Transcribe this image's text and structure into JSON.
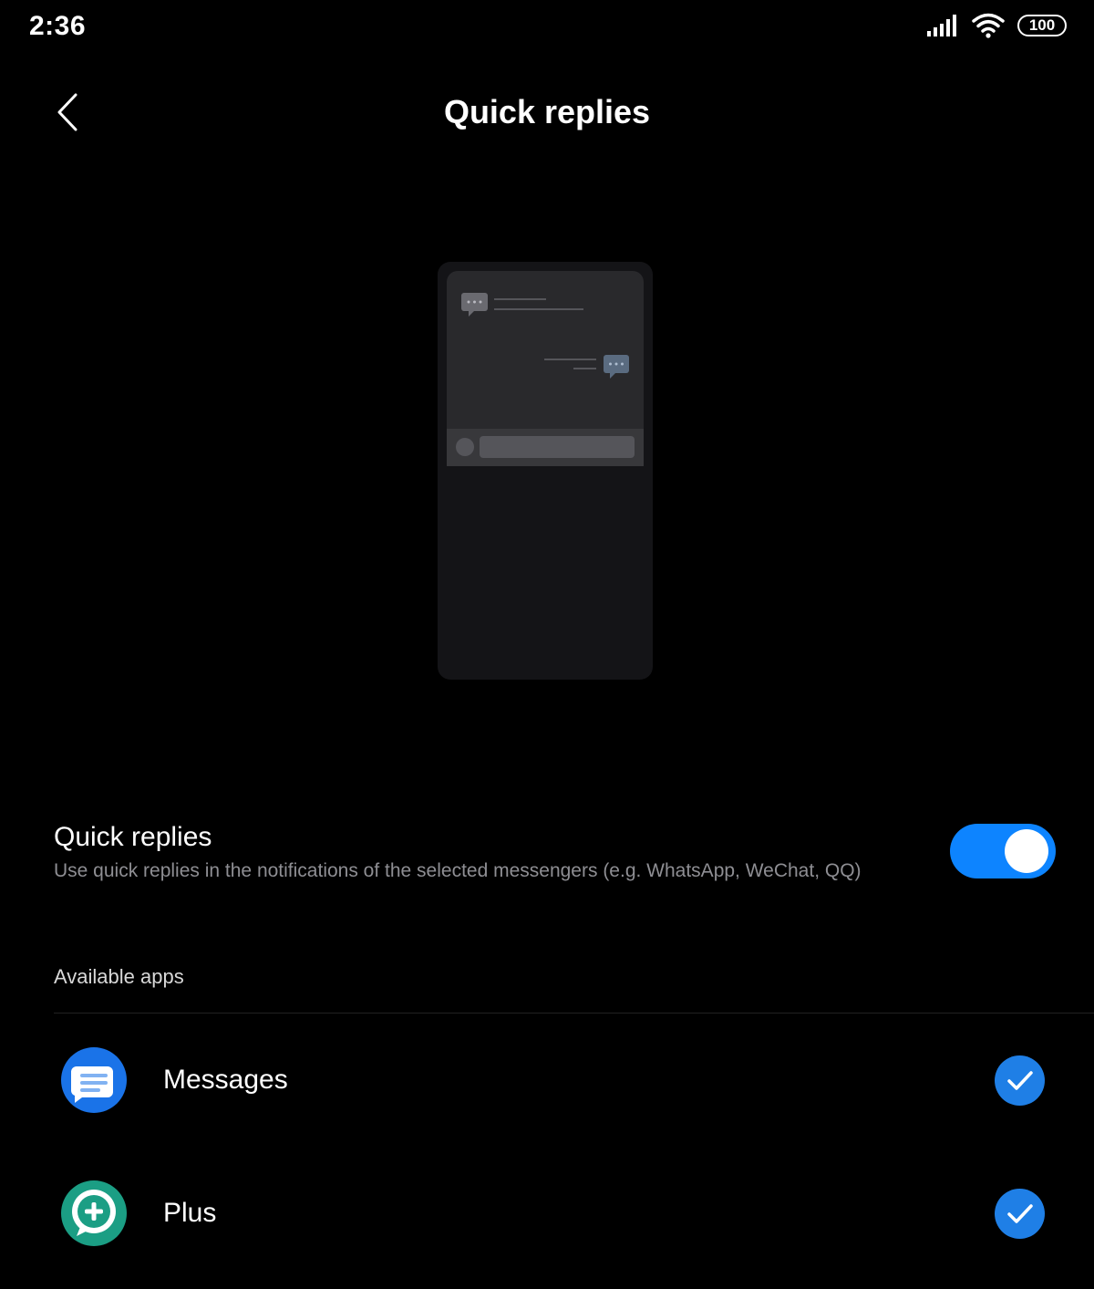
{
  "status_bar": {
    "time": "2:36",
    "battery": "100",
    "icons": [
      "signal-icon",
      "wifi-icon",
      "battery-icon"
    ]
  },
  "header": {
    "title": "Quick replies",
    "back_icon": "chevron-left-icon"
  },
  "setting": {
    "title": "Quick replies",
    "description": "Use quick replies in the notifications of the selected messengers (e.g. WhatsApp, WeChat, QQ)",
    "enabled": true
  },
  "available_apps": {
    "label": "Available apps",
    "items": [
      {
        "name": "Messages",
        "icon": "messages-app-icon",
        "checked": true
      },
      {
        "name": "Plus",
        "icon": "plus-app-icon",
        "checked": true
      }
    ]
  },
  "colors": {
    "background": "#000000",
    "accent": "#0d84ff",
    "secondary_text": "#8e8e93"
  }
}
